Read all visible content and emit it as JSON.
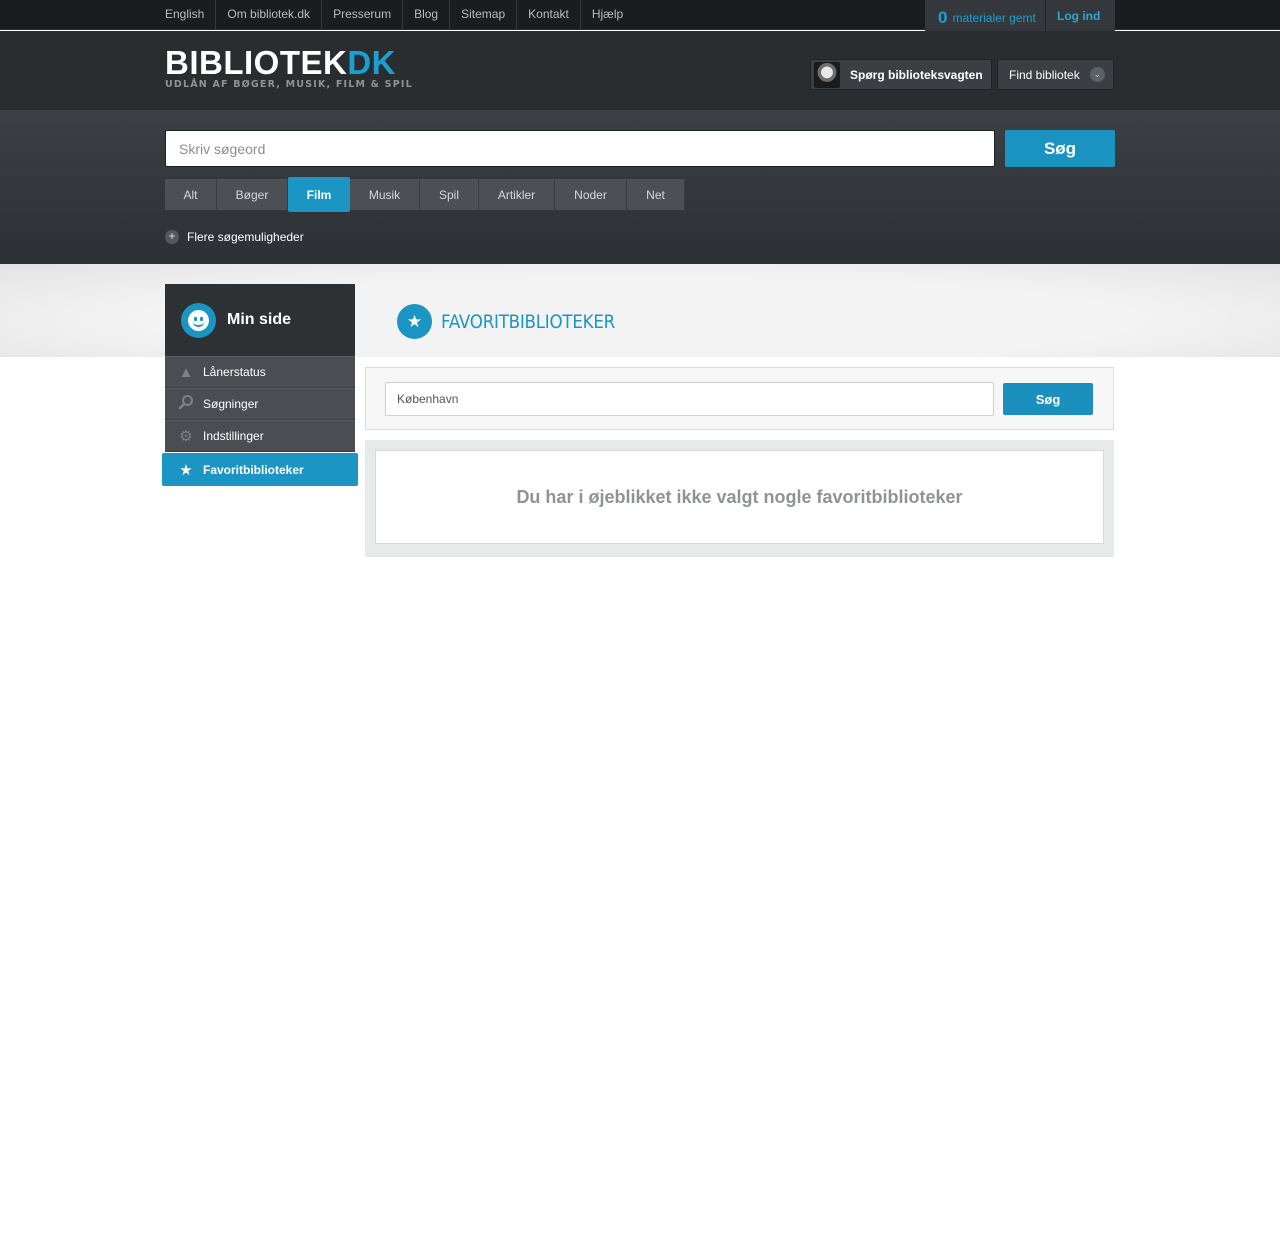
{
  "topnav": {
    "links": [
      "English",
      "Om bibliotek.dk",
      "Presserum",
      "Blog",
      "Sitemap",
      "Kontakt",
      "Hjælp"
    ]
  },
  "user": {
    "saved_count": "0",
    "saved_label": "materialer gemt",
    "login_label": "Log ind"
  },
  "header": {
    "logo_main": "BIBLIOTEK",
    "logo_accent": "DK",
    "tagline": "UDLÅN AF BØGER, MUSIK, FILM & SPIL",
    "ask_label": "Spørg biblioteksvagten",
    "find_label": "Find bibliotek"
  },
  "search": {
    "placeholder": "Skriv søgeord",
    "button": "Søg",
    "tabs": [
      "Alt",
      "Bøger",
      "Film",
      "Musik",
      "Spil",
      "Artikler",
      "Noder",
      "Net"
    ],
    "active_tab": "Film",
    "more_label": "Flere søgemuligheder"
  },
  "sidebar": {
    "title": "Min side",
    "items": [
      {
        "label": "Lånerstatus",
        "icon": "triangle-icon"
      },
      {
        "label": "Søgninger",
        "icon": "magnifier-icon"
      },
      {
        "label": "Indstillinger",
        "icon": "gear-icon"
      },
      {
        "label": "Favoritbiblioteker",
        "icon": "star-icon",
        "active": true
      }
    ]
  },
  "main": {
    "title": "FAVORITBIBLIOTEKER",
    "search_value": "København",
    "search_button": "Søg",
    "empty_message": "Du har i øjeblikket ikke valgt nogle favoritbiblioteker"
  },
  "colors": {
    "accent": "#1b95c3",
    "topbar": "#1b1c1e",
    "header": "#2a2d30"
  }
}
